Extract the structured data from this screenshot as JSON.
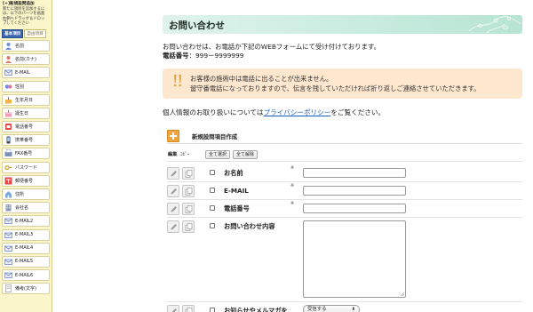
{
  "sidebar": {
    "title": "[+]新規設問追加",
    "help_lines": [
      "新たに項目を追加するには、以下のパーツを画面",
      "右側へドラッグ＆ドロッ",
      "プしてください"
    ],
    "tabs": [
      {
        "label": "基本項目",
        "active": true
      },
      {
        "label": "自由項目",
        "active": false
      }
    ],
    "items": [
      {
        "label": "名前",
        "icon": "person-icon"
      },
      {
        "label": "名前(カナ)",
        "icon": "person-kana-icon"
      },
      {
        "label": "E-MAIL",
        "icon": "email-icon"
      },
      {
        "label": "性別",
        "icon": "gender-icon"
      },
      {
        "label": "生年月日",
        "icon": "birthday-icon"
      },
      {
        "label": "誕生日",
        "icon": "cake-icon"
      },
      {
        "label": "電話番号",
        "icon": "phone-icon"
      },
      {
        "label": "携帯番号",
        "icon": "mobile-icon"
      },
      {
        "label": "FAX番号",
        "icon": "fax-icon"
      },
      {
        "label": "パスワード",
        "icon": "key-icon"
      },
      {
        "label": "郵便番号",
        "icon": "postal-icon"
      },
      {
        "label": "住所",
        "icon": "address-icon"
      },
      {
        "label": "会社名",
        "icon": "building-icon"
      },
      {
        "label": "E-MAIL2",
        "icon": "email-icon"
      },
      {
        "label": "E-MAIL3",
        "icon": "email-icon"
      },
      {
        "label": "E-MAIL4",
        "icon": "email-icon"
      },
      {
        "label": "E-MAIL5",
        "icon": "email-icon"
      },
      {
        "label": "E-MAIL6",
        "icon": "email-icon"
      },
      {
        "label": "備考(文字)",
        "icon": "note-icon"
      }
    ]
  },
  "main": {
    "title": "お問い合わせ",
    "intro_line1": "お問い合わせは、お電話か下記のWEBフォームにて受け付けております。",
    "phone_label": "電話番号",
    "phone_value": "：999ー9999999",
    "notice_line1": "お客様の施術中は電話に出ることが出来ません。",
    "notice_line2": "留守番電話になっておりますので、伝言を残していただければ折り返しご連絡させていただきます。",
    "privacy_prefix": "個人情報のお取り扱いについては",
    "privacy_link": "プライバシーポリシー",
    "privacy_suffix": "をご覧ください。"
  },
  "builder": {
    "heading": "新規設問項目作成",
    "toolbar": {
      "edit_label": "編集",
      "copy_label": "ｺﾋﾟｰ",
      "select_all": "全て選択",
      "deselect_all": "全て解除"
    },
    "required_mark": "※",
    "fields": [
      {
        "label": "お名前",
        "type": "text",
        "required": true
      },
      {
        "label": "E-MAIL",
        "type": "text",
        "required": true
      },
      {
        "label": "電話番号",
        "type": "text",
        "required": true
      },
      {
        "label": "お問い合わせ内容",
        "type": "textarea",
        "required": false
      },
      {
        "label": "お知らせやメルマガを",
        "type": "select",
        "required": false,
        "selected": "受信する"
      }
    ]
  },
  "colors": {
    "sidebar_bg": "#fbf6c9",
    "tab_active": "#3a65b0",
    "title_bar": "#c9ece0",
    "notice_bg": "#fde7cf",
    "link": "#1b5fc1",
    "add_button": "#f0a640"
  }
}
